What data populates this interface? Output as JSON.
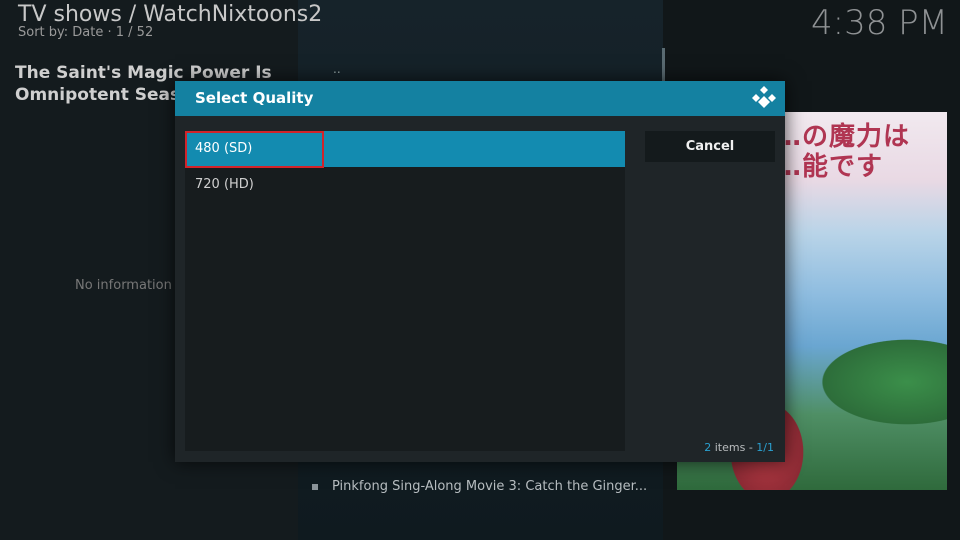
{
  "header": {
    "title": "TV shows / WatchNixtoons2",
    "subtitle": "Sort by: Date  ·  1 / 52",
    "clock": "4:38 PM"
  },
  "info_panel": {
    "title": "The Saint's Magic Power Is Omnipotent Seas",
    "no_info": "No information a"
  },
  "background_list": {
    "parent_label": "..",
    "visible_item": "Pinkfong Sing-Along Movie 3: Catch the Ginger..."
  },
  "poster": {
    "text_line1": "…の魔力は",
    "text_line2": "…能です"
  },
  "dialog": {
    "title": "Select Quality",
    "items": [
      {
        "label": "480 (SD)",
        "selected": true
      },
      {
        "label": "720 (HD)",
        "selected": false
      }
    ],
    "cancel_label": "Cancel",
    "items_count": "2",
    "items_word": " items - ",
    "page": "1/1"
  },
  "colors": {
    "accent": "#1481a1",
    "selection": "#138bb0",
    "highlight": "#d2232a"
  },
  "icons": [
    "kodi-logo-icon"
  ]
}
